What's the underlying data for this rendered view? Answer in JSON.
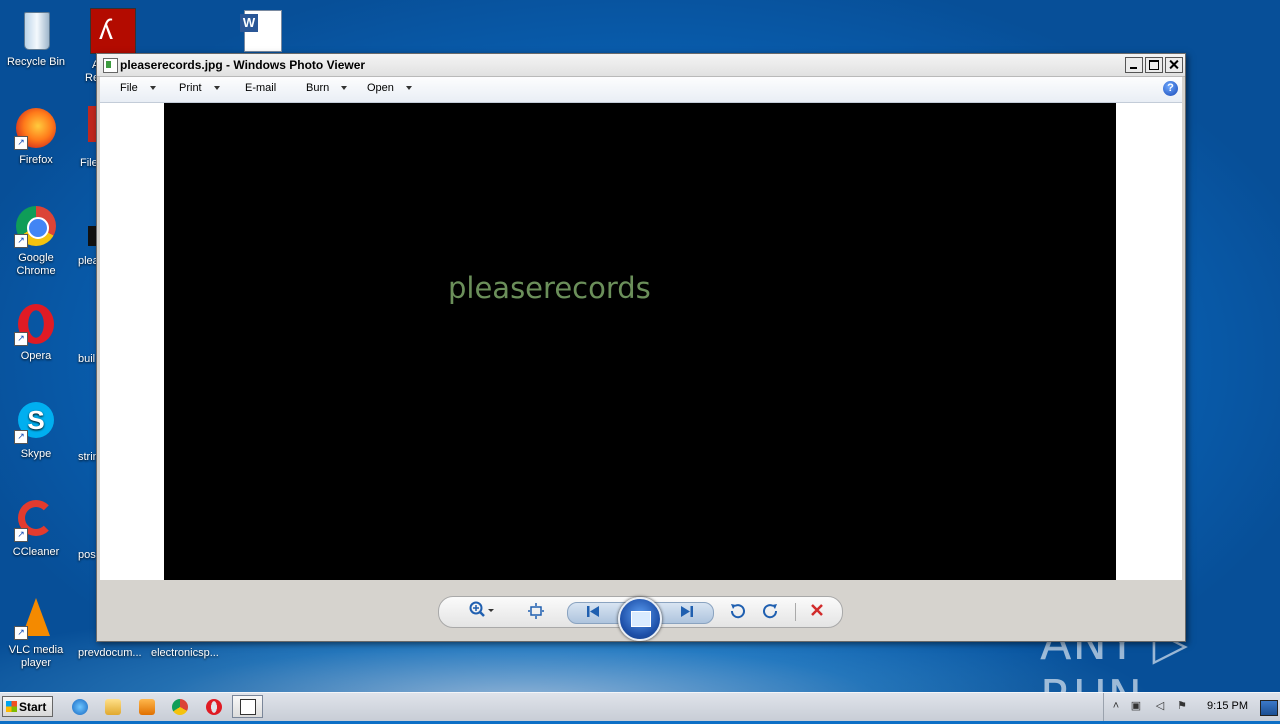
{
  "desktop": {
    "icons": [
      {
        "label": "Recycle Bin"
      },
      {
        "label": "Firefox"
      },
      {
        "label": "Google Chrome"
      },
      {
        "label": "Opera"
      },
      {
        "label": "Skype"
      },
      {
        "label": "CCleaner"
      },
      {
        "label": "VLC media player"
      }
    ],
    "partial_labels": [
      "A",
      "Re",
      "File",
      "plea",
      "buil",
      "strin",
      "pos",
      "prevdocum...",
      "electronicsp..."
    ]
  },
  "window": {
    "title": "pleaserecords.jpg - Windows Photo Viewer",
    "menu": {
      "file": "File",
      "print": "Print",
      "email": "E-mail",
      "burn": "Burn",
      "open": "Open"
    },
    "help": "?",
    "image_text": "pleaserecords"
  },
  "controls": {
    "zoom_icon": "zoom-icon",
    "fit_icon": "fit-window-icon",
    "prev_icon": "previous-icon",
    "slideshow_icon": "slideshow-icon",
    "next_icon": "next-icon",
    "rotate_ccw_icon": "rotate-counterclockwise-icon",
    "rotate_cw_icon": "rotate-clockwise-icon",
    "delete_icon": "delete-icon"
  },
  "taskbar": {
    "start_label": "Start",
    "clock": "9:15 PM",
    "pinned": [
      "internet-explorer-icon",
      "explorer-icon",
      "media-player-icon",
      "chrome-icon",
      "opera-icon",
      "photo-viewer-icon"
    ]
  },
  "watermark": "ANY ▷ RUN",
  "colors": {
    "image_text": "#6b8f5a",
    "desktop_blue": "#0d6fc6"
  }
}
